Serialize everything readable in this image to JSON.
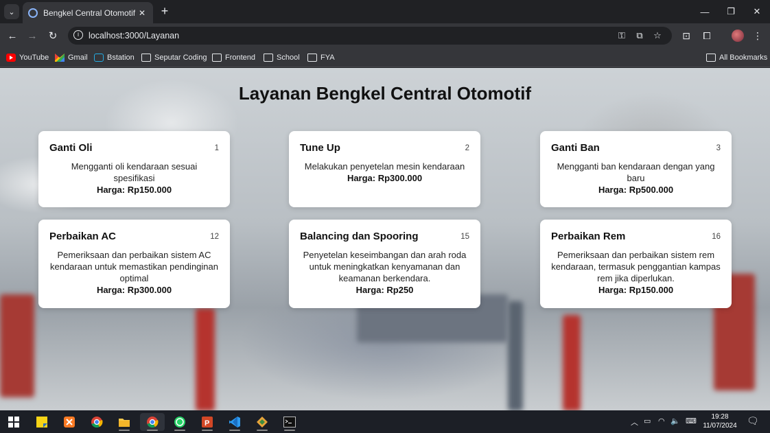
{
  "browser": {
    "tab_title": "Bengkel Central Otomotif",
    "url": "localhost:3000/Layanan",
    "bookmarks": [
      {
        "label": "YouTube",
        "icon": "youtube-icon"
      },
      {
        "label": "Gmail",
        "icon": "gmail-icon"
      },
      {
        "label": "Bstation",
        "icon": "bstation-icon"
      },
      {
        "label": "Seputar Coding",
        "icon": "folder-icon"
      },
      {
        "label": "Frontend",
        "icon": "folder-icon"
      },
      {
        "label": "School",
        "icon": "folder-icon"
      },
      {
        "label": "FYA",
        "icon": "folder-icon"
      }
    ],
    "all_bookmarks": "All Bookmarks"
  },
  "page": {
    "heading": "Layanan Bengkel Central Otomotif",
    "services": [
      {
        "id": "1",
        "title": "Ganti Oli",
        "description": "Mengganti oli kendaraan sesuai spesifikasi",
        "price": "Harga: Rp150.000"
      },
      {
        "id": "2",
        "title": "Tune Up",
        "description": "Melakukan penyetelan mesin kendaraan",
        "price": "Harga: Rp300.000"
      },
      {
        "id": "3",
        "title": "Ganti Ban",
        "description": "Mengganti ban kendaraan dengan yang baru",
        "price": "Harga: Rp500.000"
      },
      {
        "id": "12",
        "title": "Perbaikan AC",
        "description": "Pemeriksaan dan perbaikan sistem AC kendaraan untuk memastikan pendinginan optimal",
        "price": "Harga: Rp300.000"
      },
      {
        "id": "15",
        "title": "Balancing dan Spooring",
        "description": "Penyetelan keseimbangan dan arah roda untuk meningkatkan kenyamanan dan keamanan berkendara.",
        "price": "Harga: Rp250"
      },
      {
        "id": "16",
        "title": "Perbaikan Rem",
        "description": "Pemeriksaan dan perbaikan sistem rem kendaraan, termasuk penggantian kampas rem jika diperlukan.",
        "price": "Harga: Rp150.000"
      }
    ]
  },
  "taskbar": {
    "time": "19:28",
    "date": "11/07/2024"
  }
}
